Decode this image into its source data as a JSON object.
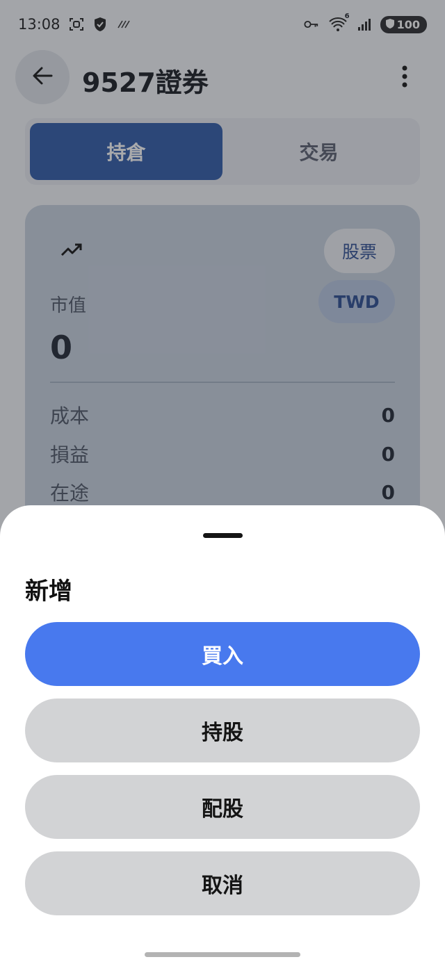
{
  "status_bar": {
    "time": "13:08",
    "battery": "100",
    "wifi_badge": "6",
    "icons": [
      "screenshot-icon",
      "shield-icon",
      "no-data-icon",
      "key-icon",
      "wifi-icon",
      "signal-icon",
      "battery-shield-icon"
    ]
  },
  "app_bar": {
    "title": "9527證券",
    "back_icon": "arrow-left-icon",
    "more_icon": "more-vertical-icon"
  },
  "tabs": [
    {
      "label": "持倉",
      "selected": true
    },
    {
      "label": "交易",
      "selected": false
    }
  ],
  "summary_card": {
    "trend_icon": "trending-up-icon",
    "type_chip": "股票",
    "currency_chip": "TWD",
    "market_value_label": "市值",
    "market_value": "0",
    "rows": [
      {
        "label": "成本",
        "value": "0"
      },
      {
        "label": "損益",
        "value": "0"
      },
      {
        "label": "在途",
        "value": "0"
      }
    ]
  },
  "bottom_sheet": {
    "title": "新增",
    "buttons": [
      {
        "label": "買入",
        "style": "primary"
      },
      {
        "label": "持股",
        "style": "secondary"
      },
      {
        "label": "配股",
        "style": "secondary"
      },
      {
        "label": "取消",
        "style": "secondary"
      }
    ]
  },
  "colors": {
    "primary": "#4879ee",
    "selected_tab": "#2f5aa8",
    "secondary_button": "#d2d3d5",
    "sheet_background": "#ffffff"
  }
}
